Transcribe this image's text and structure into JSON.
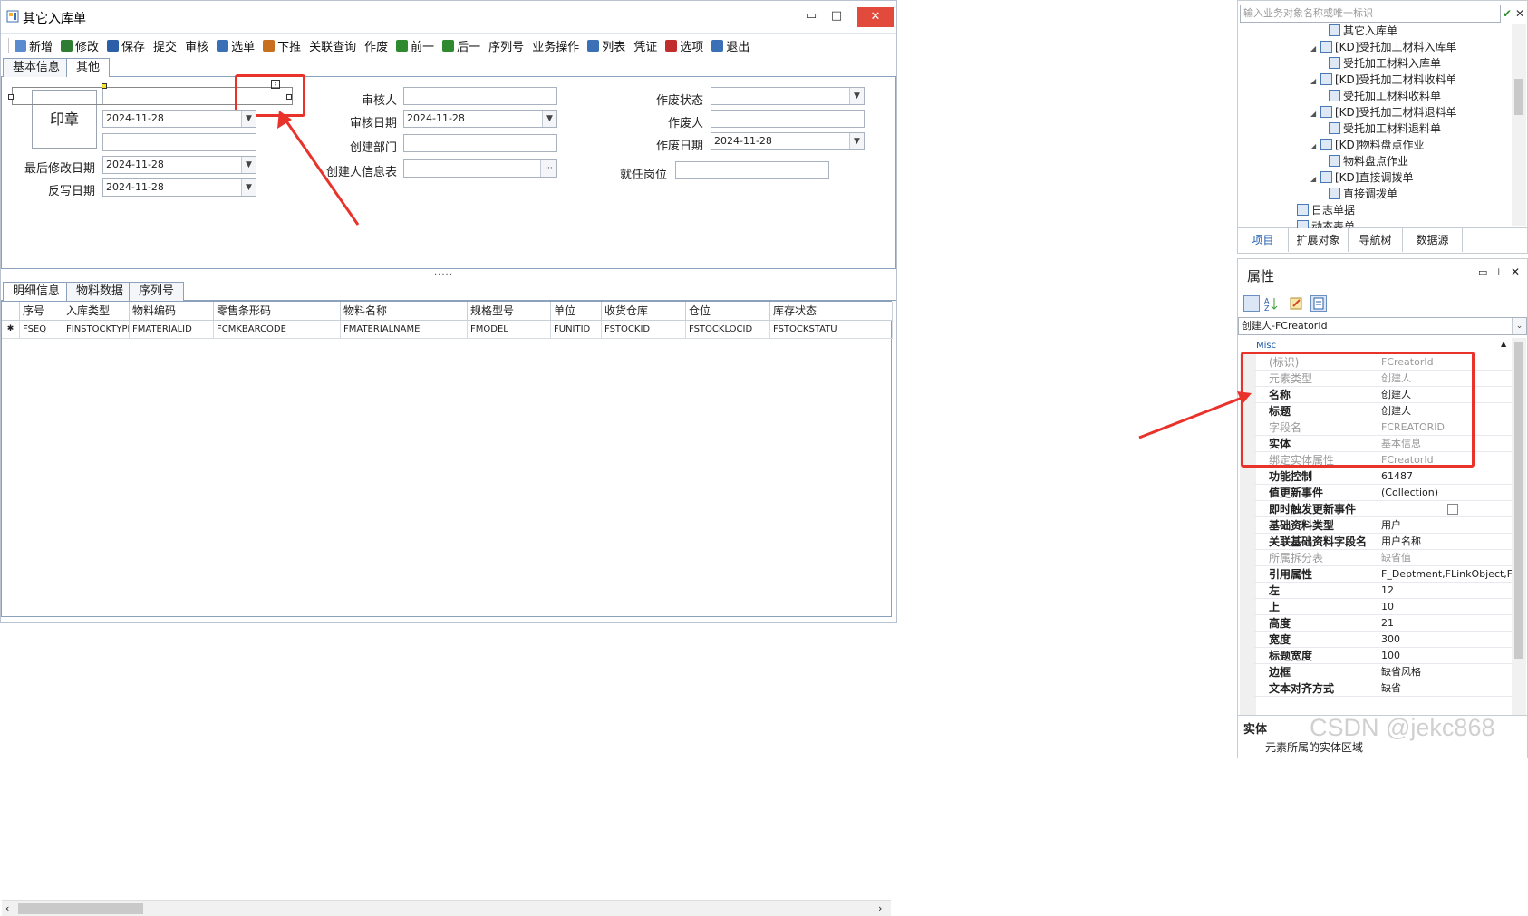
{
  "window": {
    "title": "其它入库单",
    "controls": {
      "minimize": "▭",
      "maximize": "□",
      "close": "✕"
    }
  },
  "toolbar": {
    "items": [
      "新增",
      "修改",
      "保存",
      "提交",
      "审核",
      "选单",
      "下推",
      "关联查询",
      "作废",
      "前一",
      "后一",
      "序列号",
      "业务操作",
      "列表",
      "凭证",
      "选项",
      "退出"
    ]
  },
  "form_tabs": [
    "基本信息",
    "其他"
  ],
  "form": {
    "stamp": "印章",
    "date1": "2024-11-28",
    "last_modified_label": "最后修改日期",
    "last_modified_value": "2024-11-28",
    "unaudit_date_label": "反写日期",
    "unaudit_date_value": "2024-11-28",
    "auditor_label": "审核人",
    "audit_date_label": "审核日期",
    "audit_date_value": "2024-11-28",
    "create_dept_label": "创建部门",
    "creator_info_label": "创建人信息表",
    "creator_info_btn": "···",
    "void_status_label": "作废状态",
    "voider_label": "作废人",
    "void_date_label": "作废日期",
    "void_date_value": "2024-11-28",
    "position_label": "就任岗位",
    "splitter": "·····"
  },
  "detail_tabs": [
    "明细信息",
    "物料数据",
    "序列号"
  ],
  "grid": {
    "columns": [
      "序号",
      "入库类型",
      "物料编码",
      "零售条形码",
      "物料名称",
      "规格型号",
      "单位",
      "收货仓库",
      "仓位",
      "库存状态"
    ],
    "row": [
      "FSEQ",
      "FINSTOCKTYPE",
      "FMATERIALID",
      "FCMKBARCODE",
      "FMATERIALNAME",
      "FMODEL",
      "FUNITID",
      "FSTOCKID",
      "FSTOCKLOCID",
      "FSTOCKSTATU"
    ],
    "new_row_marker": "✱"
  },
  "tree_panel": {
    "search_placeholder": "输入业务对象名称或唯一标识",
    "items": [
      {
        "label": "其它入库单",
        "level": 3
      },
      {
        "label": "[KD]受托加工材料入库单",
        "level": 2
      },
      {
        "label": "受托加工材料入库单",
        "level": 3
      },
      {
        "label": "[KD]受托加工材料收料单",
        "level": 2
      },
      {
        "label": "受托加工材料收料单",
        "level": 3
      },
      {
        "label": "[KD]受托加工材料退料单",
        "level": 2
      },
      {
        "label": "受托加工材料退料单",
        "level": 3
      },
      {
        "label": "[KD]物料盘点作业",
        "level": 2
      },
      {
        "label": "物料盘点作业",
        "level": 3
      },
      {
        "label": "[KD]直接调拨单",
        "level": 2
      },
      {
        "label": "直接调拨单",
        "level": 3
      },
      {
        "label": "日志单据",
        "level": 1
      },
      {
        "label": "动态表单",
        "level": 1
      }
    ],
    "tabs": [
      "项目",
      "扩展对象",
      "导航树",
      "数据源"
    ]
  },
  "properties": {
    "title": "属性",
    "selector": "创建人-FCreatorId",
    "category": "Misc",
    "rows": [
      {
        "name": "(标识)",
        "value": "FCreatorId",
        "dim": true
      },
      {
        "name": "元素类型",
        "value": "创建人",
        "dim": true
      },
      {
        "name": "名称",
        "value": "创建人",
        "dim": false
      },
      {
        "name": "标题",
        "value": "创建人",
        "dim": false
      },
      {
        "name": "字段名",
        "value": "FCREATORID",
        "dim": true
      },
      {
        "name": "实体",
        "value": "基本信息",
        "dim": false,
        "vdim": true
      },
      {
        "name": "绑定实体属性",
        "value": "FCreatorId",
        "dim": true
      },
      {
        "name": "功能控制",
        "value": "61487",
        "dim": false
      },
      {
        "name": "值更新事件",
        "value": "(Collection)",
        "dim": false
      },
      {
        "name": "即时触发更新事件",
        "value": "",
        "dim": false,
        "checkbox": true
      },
      {
        "name": "基础资料类型",
        "value": "用户",
        "dim": false
      },
      {
        "name": "关联基础资料字段名",
        "value": "用户名称",
        "dim": false
      },
      {
        "name": "所属拆分表",
        "value": "缺省值",
        "dim": true
      },
      {
        "name": "引用属性",
        "value": "F_Deptment,FLinkObject,F...",
        "dim": false
      },
      {
        "name": "左",
        "value": "12",
        "dim": false
      },
      {
        "name": "上",
        "value": "10",
        "dim": false
      },
      {
        "name": "高度",
        "value": "21",
        "dim": false
      },
      {
        "name": "宽度",
        "value": "300",
        "dim": false
      },
      {
        "name": "标题宽度",
        "value": "100",
        "dim": false
      },
      {
        "name": "边框",
        "value": "缺省风格",
        "dim": false
      },
      {
        "name": "文本对齐方式",
        "value": "缺省",
        "dim": false
      }
    ],
    "desc_title": "实体",
    "desc_text": "元素所属的实体区域"
  },
  "watermark": "CSDN @jekc868",
  "colors": {
    "accent": "#e8322a",
    "tab_blue": "#1a5aa8",
    "border": "#8aa0bb"
  }
}
